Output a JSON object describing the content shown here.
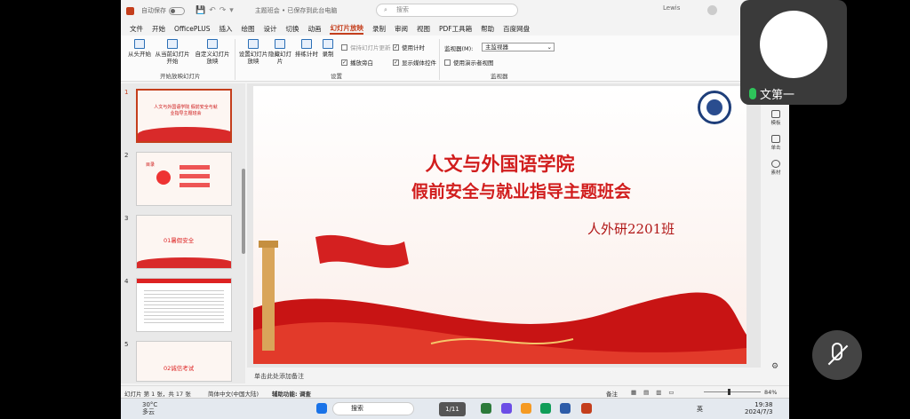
{
  "titlebar": {
    "autosave": "自动保存",
    "doc_title": "主题班会 • 已保存到此台电脑",
    "search_placeholder": "搜索",
    "user": "Lewis"
  },
  "menu": [
    "文件",
    "开始",
    "OfficePLUS",
    "插入",
    "绘图",
    "设计",
    "切换",
    "动画",
    "幻灯片放映",
    "录制",
    "审阅",
    "视图",
    "PDF工具箱",
    "帮助",
    "百度网盘"
  ],
  "menu_active_index": 8,
  "ribbon": {
    "buttons": [
      "从头开始",
      "从当前幻灯片开始",
      "自定义幻灯片放映",
      "设置幻灯片放映",
      "隐藏幻灯片",
      "排练计时",
      "录制"
    ],
    "group_start": "开始放映幻灯片",
    "group_setup": "设置",
    "group_monitor": "监视器",
    "checks": [
      {
        "label": "保持幻灯片更新",
        "checked": false
      },
      {
        "label": "使用计时",
        "checked": true
      },
      {
        "label": "播放旁白",
        "checked": true
      },
      {
        "label": "显示媒体控件",
        "checked": true
      }
    ],
    "monitor_label": "监视器(M):",
    "monitor_value": "主监视器",
    "presenter_view": "使用演示者视图"
  },
  "thumbnails": [
    {
      "num": "1",
      "text": "人文与外国语学院 假前安全与就业指导主题班会"
    },
    {
      "num": "2",
      "text": "目录"
    },
    {
      "num": "3",
      "text": "01暑假安全"
    },
    {
      "num": "4",
      "text": ""
    },
    {
      "num": "5",
      "text": "02诚信考试"
    }
  ],
  "slide": {
    "title1": "人文与外国语学院",
    "title2": "假前安全与就业指导主题班会",
    "class": "人外研2201班"
  },
  "notes_placeholder": "单击此处添加备注",
  "rightbar": [
    "模板",
    "单击",
    "素材"
  ],
  "status": {
    "slide_info": "幻灯片 第 1 张，共 17 张",
    "language": "简体中文(中国大陆)",
    "accessibility": "辅助功能: 调查",
    "notes": "备注",
    "zoom": "84%"
  },
  "taskbar": {
    "weather_temp": "30°C",
    "weather_desc": "多云",
    "search": "搜索",
    "time": "19:38",
    "date": "2024/7/3",
    "lang": "英",
    "pages": "1/11"
  },
  "call": {
    "name": "文第一"
  }
}
